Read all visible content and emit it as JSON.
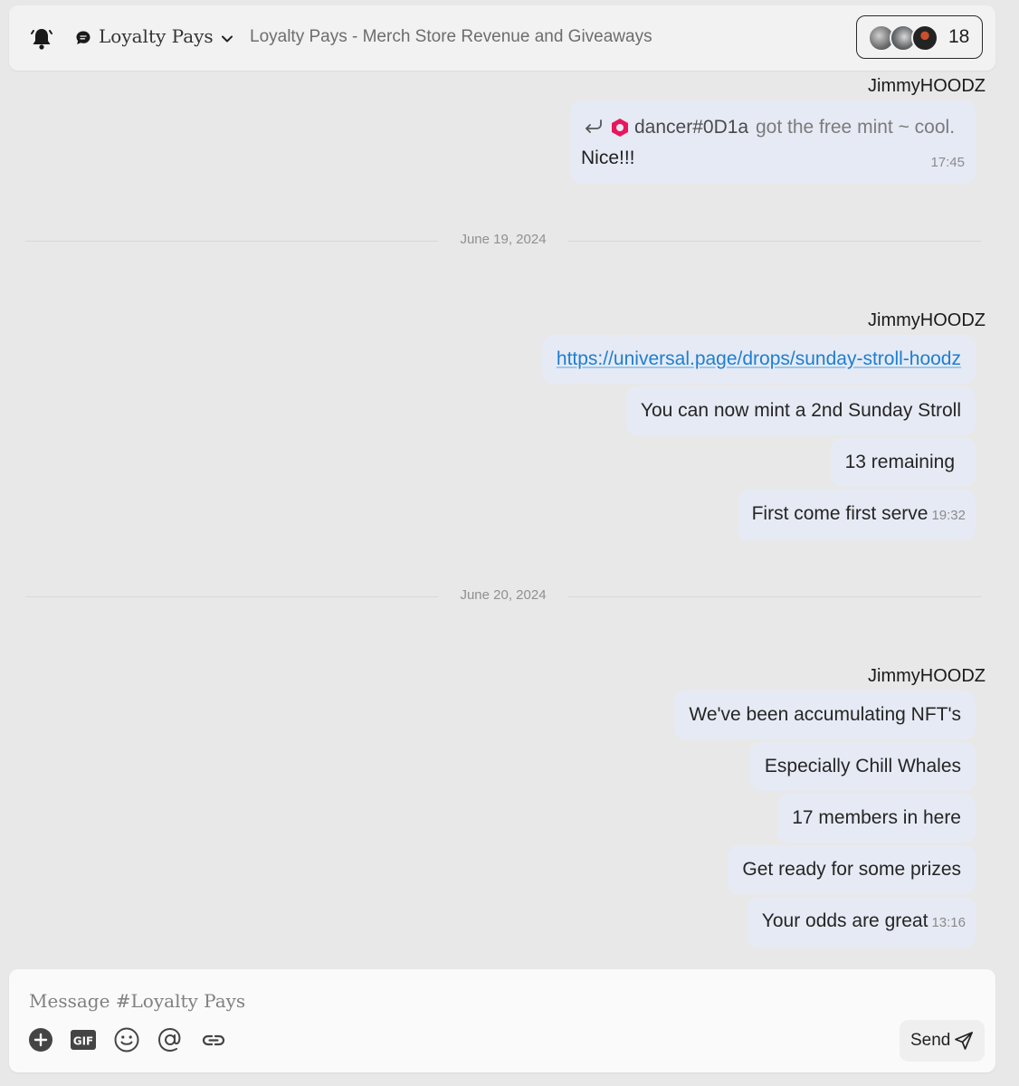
{
  "header": {
    "channel_name": "Loyalty Pays",
    "channel_topic": "Loyalty Pays - Merch Store Revenue and Giveaways",
    "member_count": "18",
    "icons": [
      "bell-icon",
      "chat-bubble-icon",
      "chevron-down-icon"
    ]
  },
  "messages": {
    "group1": {
      "sender": "JimmyHOODZ",
      "reply": {
        "author": "dancer#0D1a",
        "quoted_text": "got the free mint ~ cool."
      },
      "text": "Nice!!!",
      "time": "17:45"
    },
    "date1": "June 19, 2024",
    "group2": {
      "sender": "JimmyHOODZ",
      "link": "https://universal.page/drops/sunday-stroll-hoodz",
      "m2": "You can now mint a 2nd Sunday Stroll",
      "m3": "13 remaining",
      "m4": "First come first serve",
      "time": "19:32"
    },
    "date2": "June 20, 2024",
    "group3": {
      "sender": "JimmyHOODZ",
      "m1": "We've been accumulating NFT's",
      "m2": "Especially Chill Whales",
      "m3": "17 members in here",
      "m4": "Get ready for some prizes",
      "m5": "Your odds are great",
      "time": "13:16"
    }
  },
  "composer": {
    "placeholder": "Message #Loyalty Pays",
    "send_label": "Send",
    "tools": [
      "add-icon",
      "gif-icon",
      "emoji-icon",
      "mention-icon",
      "link-icon"
    ]
  },
  "colors": {
    "background": "#e8e8e8",
    "bubble": "#e6eaf4",
    "link": "#1d7fd0",
    "badge": "#e8175d"
  }
}
